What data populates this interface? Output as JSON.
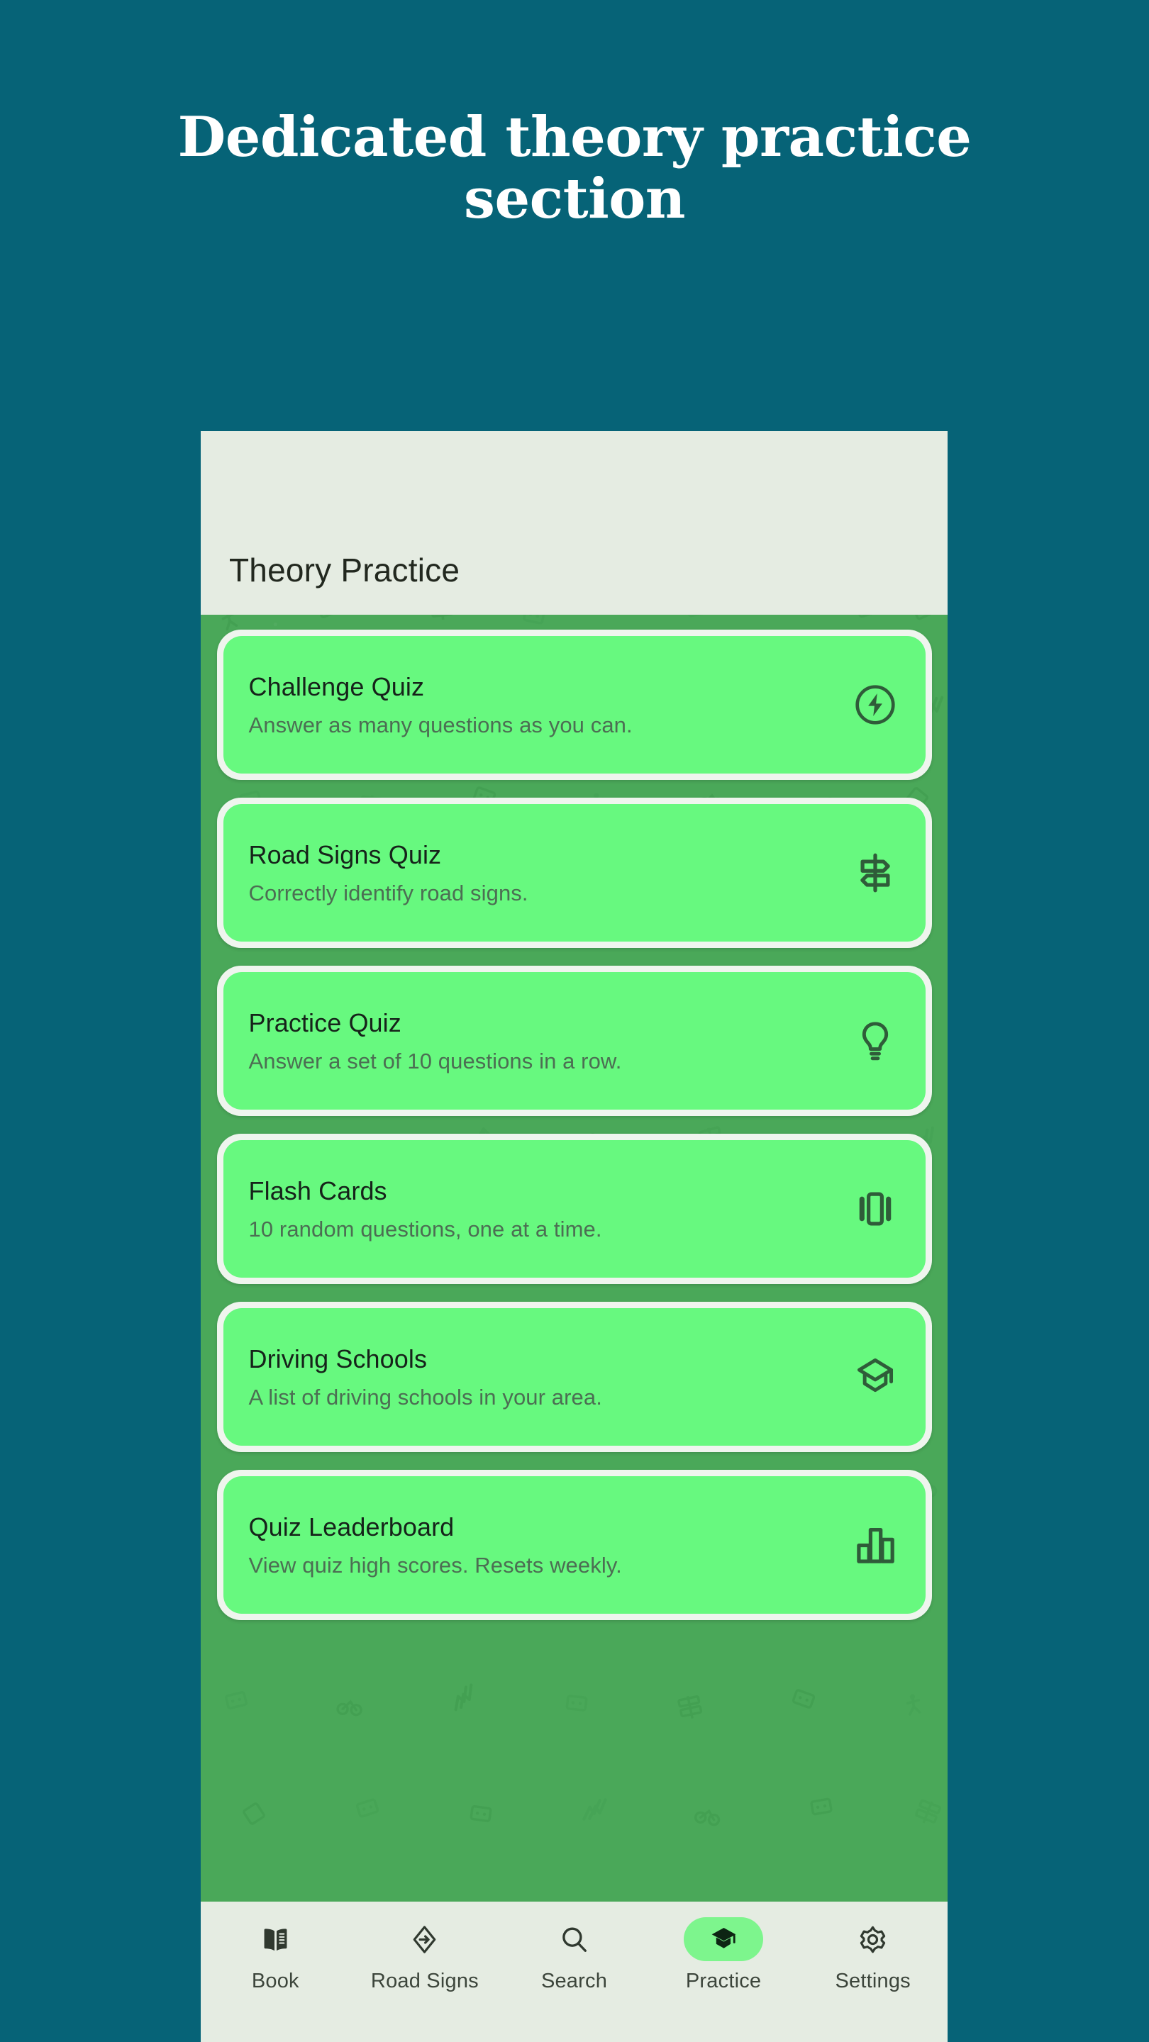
{
  "headline": "Dedicated theory practice section",
  "colors": {
    "page_background": "#066377",
    "app_surface": "#e5ece2",
    "pattern_green": "#4aa859",
    "card_green": "#67f97f",
    "card_border": "#eff5ee",
    "title_text": "#16231a",
    "subtitle_text": "#4c6e53",
    "active_pill": "#7df58d"
  },
  "app": {
    "appbar": {
      "title": "Theory Practice"
    },
    "cards": [
      {
        "title": "Challenge Quiz",
        "subtitle": "Answer as many questions as you can.",
        "icon": "lightning-bolt-circle-icon"
      },
      {
        "title": "Road Signs Quiz",
        "subtitle": "Correctly identify road signs.",
        "icon": "signpost-icon"
      },
      {
        "title": "Practice Quiz",
        "subtitle": "Answer a set of 10 questions in a row.",
        "icon": "lightbulb-icon"
      },
      {
        "title": "Flash Cards",
        "subtitle": "10 random questions, one at a time.",
        "icon": "card-carousel-icon"
      },
      {
        "title": "Driving Schools",
        "subtitle": "A list of driving schools in your area.",
        "icon": "graduation-cap-icon"
      },
      {
        "title": "Quiz Leaderboard",
        "subtitle": "View quiz high scores. Resets weekly.",
        "icon": "bar-chart-icon"
      }
    ],
    "bottom_nav": {
      "active_index": 3,
      "items": [
        {
          "label": "Book",
          "icon": "open-book-icon"
        },
        {
          "label": "Road Signs",
          "icon": "road-sign-diamond-icon"
        },
        {
          "label": "Search",
          "icon": "search-icon"
        },
        {
          "label": "Practice",
          "icon": "graduation-cap-icon"
        },
        {
          "label": "Settings",
          "icon": "gear-icon"
        }
      ]
    }
  }
}
